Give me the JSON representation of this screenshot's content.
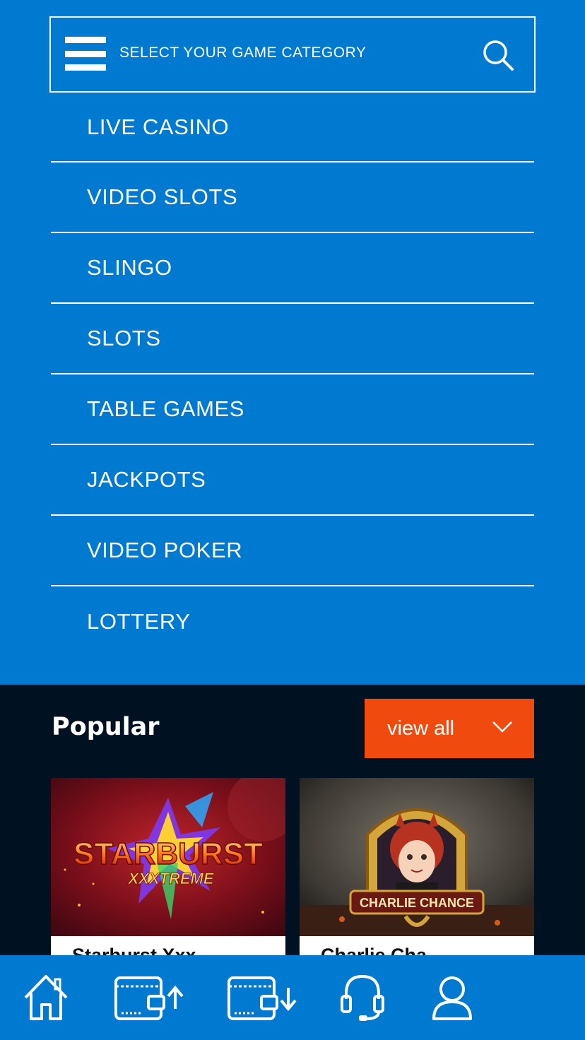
{
  "header": {
    "label": "SELECT YOUR GAME CATEGORY",
    "menu_icon": "hamburger-icon",
    "search_icon": "search-icon"
  },
  "categories": [
    {
      "label": "LIVE CASINO"
    },
    {
      "label": "VIDEO SLOTS"
    },
    {
      "label": "SLINGO"
    },
    {
      "label": "SLOTS"
    },
    {
      "label": "TABLE GAMES"
    },
    {
      "label": "JACKPOTS"
    },
    {
      "label": "VIDEO POKER"
    },
    {
      "label": "LOTTERY"
    }
  ],
  "popular": {
    "title": "Popular",
    "view_all_label": "view all",
    "games": [
      {
        "name": "Starburst Xxx",
        "logo_text": "STARBURST",
        "logo_sub": "XXXTREME"
      },
      {
        "name": "Charlie Cha",
        "logo_text": "CHARLIE CHANCE"
      }
    ]
  },
  "bottom_nav": [
    {
      "icon": "home-icon"
    },
    {
      "icon": "wallet-deposit-icon"
    },
    {
      "icon": "wallet-withdraw-icon"
    },
    {
      "icon": "support-headset-icon"
    },
    {
      "icon": "account-user-icon"
    }
  ],
  "colors": {
    "primary_blue": "#0079d1",
    "dark_panel": "#001222",
    "accent_orange": "#f04a0f"
  }
}
